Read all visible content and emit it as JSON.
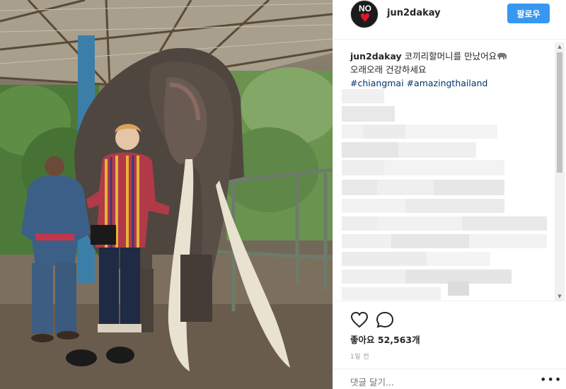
{
  "header": {
    "avatar_text": "NO",
    "username": "jun2dakay",
    "follow_label": "팔로우"
  },
  "caption": {
    "username": "jun2dakay",
    "line1": "코끼리할머니를 만났어요",
    "line2": "오래오래 건강하세요",
    "hashtags": [
      "#chiangmai",
      "#amazingthailand"
    ]
  },
  "actions": {
    "likes_label": "좋아요",
    "likes_count": "52,563개",
    "time_ago": "1일 전"
  },
  "comment": {
    "placeholder": "댓글 달기..."
  },
  "icons": [
    "heart-icon",
    "comment-icon",
    "elephant-emoji-icon",
    "more-options-icon",
    "scroll-up-icon",
    "scroll-down-icon"
  ],
  "colors": {
    "follow_button": "#3897f0",
    "hashtag": "#003569",
    "border": "#efefef"
  }
}
